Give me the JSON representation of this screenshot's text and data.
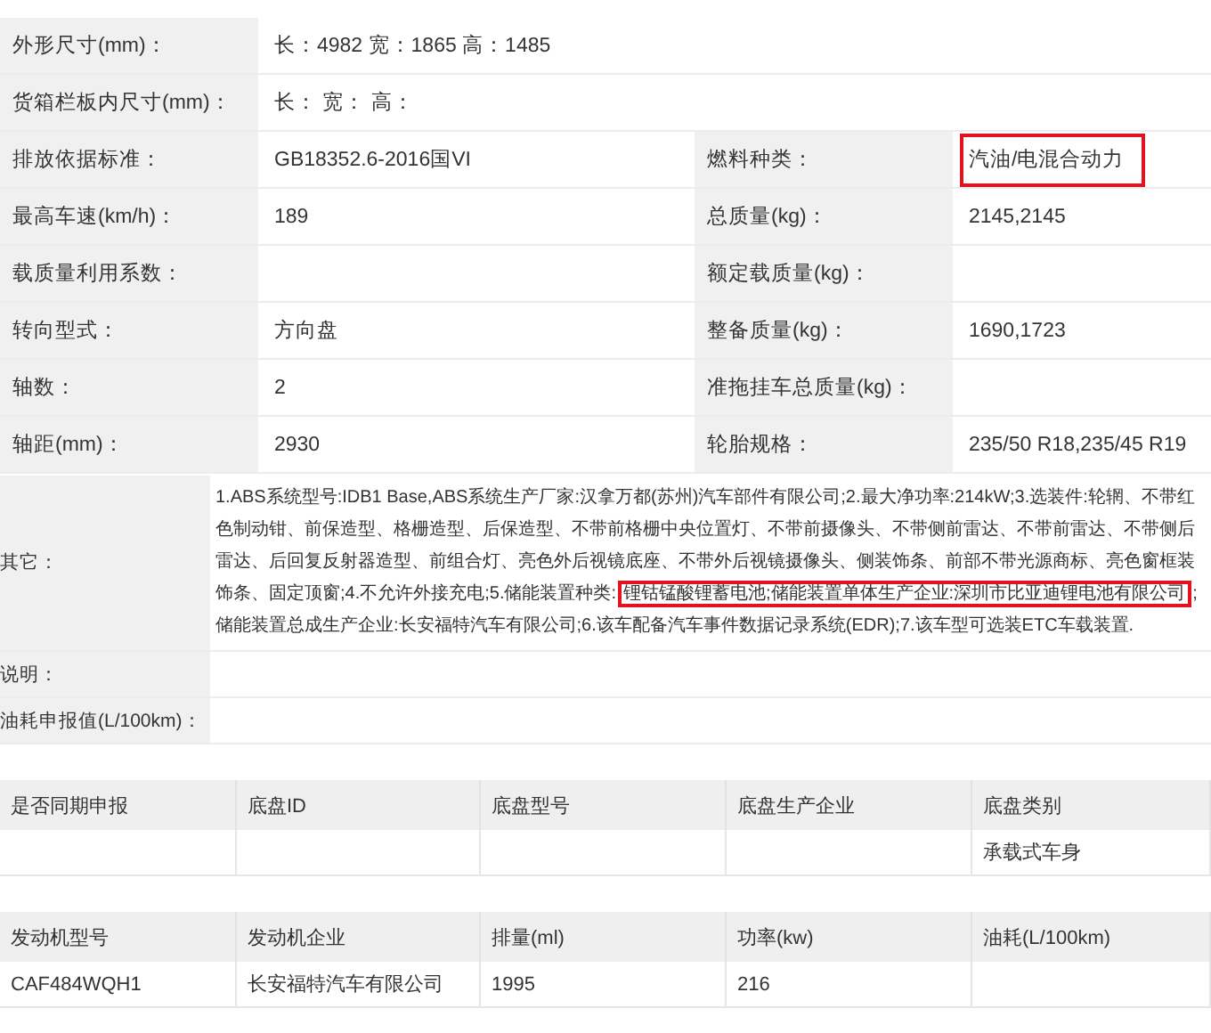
{
  "spec_rows": [
    {
      "cells": [
        {
          "label": "外形尺寸(mm)：",
          "value": "长：4982 宽：1865 高：1485",
          "highlighted": false
        }
      ]
    },
    {
      "cells": [
        {
          "label": "货箱栏板内尺寸(mm)：",
          "value": "长：  宽：  高：",
          "highlighted": false
        }
      ]
    },
    {
      "cells": [
        {
          "label": "排放依据标准：",
          "value": "GB18352.6-2016国VI",
          "highlighted": false
        },
        {
          "label": "燃料种类：",
          "value": "汽油/电混合动力",
          "highlighted": true
        }
      ]
    },
    {
      "cells": [
        {
          "label": "最高车速(km/h)：",
          "value": "189",
          "highlighted": false
        },
        {
          "label": "总质量(kg)：",
          "value": "2145,2145",
          "highlighted": false
        }
      ]
    },
    {
      "cells": [
        {
          "label": "载质量利用系数：",
          "highlighted": false
        },
        {
          "label": "额定载质量(kg)：",
          "highlighted": false
        }
      ]
    },
    {
      "cells": [
        {
          "label": "转向型式：",
          "value": "方向盘",
          "highlighted": false
        },
        {
          "label": "整备质量(kg)：",
          "value": "1690,1723",
          "highlighted": false
        }
      ]
    },
    {
      "cells": [
        {
          "label": "轴数：",
          "value": "2",
          "highlighted": false
        },
        {
          "label": "准拖挂车总质量(kg)：",
          "highlighted": false
        }
      ]
    },
    {
      "cells": [
        {
          "label": "轴距(mm)：",
          "value": "2930",
          "highlighted": false
        },
        {
          "label": "轮胎规格：",
          "value": "235/50 R18,235/45 R19",
          "highlighted": false
        }
      ]
    }
  ],
  "notes_rows": [
    {
      "label": "其它：",
      "segments": [
        {
          "text": "1.ABS系统型号:IDB1 Base,ABS系统生产厂家:汉拿万都(苏州)汽车部件有限公司;2.最大净功率:214kW;3.选装件:轮辋、不带红色制动钳、前保造型、格栅造型、后保造型、不带前格栅中央位置灯、不带前摄像头、不带侧前雷达、不带前雷达、不带侧后雷达、后回复反射器造型、前组合灯、亮色外后视镜底座、不带外后视镜摄像头、侧装饰条、前部不带光源商标、亮色窗框装饰条、固定顶窗;4.不允许外接充电;5.储能装置种类:",
          "highlighted": false
        },
        {
          "text": "锂钴锰酸锂蓄电池;储能装置单体生产企业:深圳市比亚迪锂电池有限公司",
          "highlighted": true
        },
        {
          "text": ";储能装置总成生产企业:长安福特汽车有限公司;6.该车配备汽车事件数据记录系统(EDR);7.该车型可选装ETC车载装置.",
          "highlighted": false
        }
      ]
    },
    {
      "label": "说明：",
      "segments": []
    },
    {
      "label": "油耗申报值(L/100km)：",
      "segments": []
    }
  ],
  "chassis_table": {
    "columns": [
      "是否同期申报",
      "底盘ID",
      "底盘型号",
      "底盘生产企业",
      "底盘类别"
    ],
    "rows": [
      [
        "",
        "",
        "",
        "",
        "承载式车身"
      ]
    ]
  },
  "engine_table": {
    "columns": [
      "发动机型号",
      "发动机企业",
      "排量(ml)",
      "功率(kw)",
      "油耗(L/100km)"
    ],
    "rows": [
      [
        "CAF484WQH1",
        "长安福特汽车有限公司",
        "1995",
        "216",
        ""
      ]
    ]
  }
}
